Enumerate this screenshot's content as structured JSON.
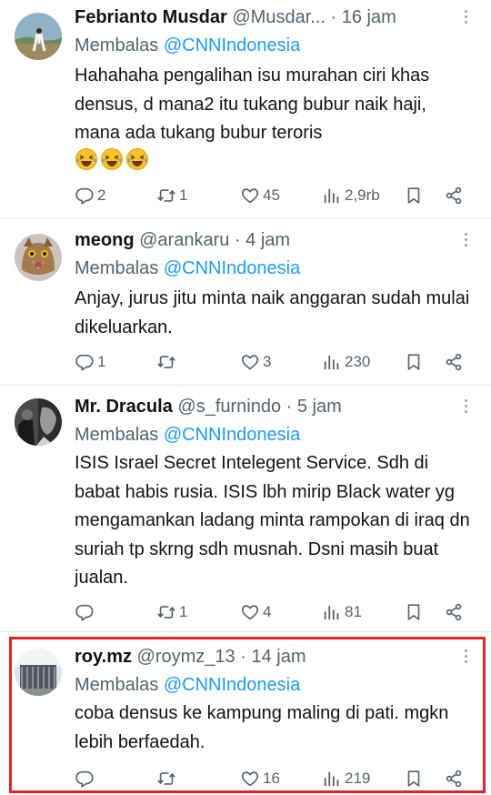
{
  "replies": [
    {
      "name": "Febrianto Musdar",
      "handle": "@Musdar...",
      "separator": "·",
      "time": "16 jam",
      "reply_prefix": "Membalas",
      "reply_to": "@CNNIndonesia",
      "text": "Hahahaha pengalihan isu murahan ciri khas densus, d mana2 itu tukang bubur naik haji, mana ada tukang bubur teroris",
      "emojis": [
        "rolling-on-floor-laughing-emoji",
        "rolling-on-floor-laughing-emoji",
        "rolling-on-floor-laughing-emoji"
      ],
      "stats": {
        "replies": "2",
        "reposts": "1",
        "likes": "45",
        "views": "2,9rb"
      }
    },
    {
      "name": "meong",
      "handle": "@arankaru",
      "separator": "·",
      "time": "4 jam",
      "reply_prefix": "Membalas",
      "reply_to": "@CNNIndonesia",
      "text": "Anjay, jurus jitu minta naik anggaran sudah mulai dikeluarkan.",
      "stats": {
        "replies": "1",
        "reposts": "",
        "likes": "3",
        "views": "230"
      }
    },
    {
      "name": "Mr. Dracula",
      "handle": "@s_furnindo",
      "separator": "·",
      "time": "5 jam",
      "reply_prefix": "Membalas",
      "reply_to": "@CNNIndonesia",
      "text": "ISIS Israel Secret Intelegent Service. Sdh di babat habis rusia. ISIS lbh mirip Black water yg mengamankan ladang minta rampokan di iraq dn suriah tp skrng sdh musnah. Dsni masih buat jualan.",
      "stats": {
        "replies": "",
        "reposts": "1",
        "likes": "4",
        "views": "81"
      }
    },
    {
      "name": "roy.mz",
      "handle": "@roymz_13",
      "separator": "·",
      "time": "14 jam",
      "reply_prefix": "Membalas",
      "reply_to": "@CNNIndonesia",
      "text": "coba densus ke kampung maling di pati. mgkn lebih berfaedah.",
      "stats": {
        "replies": "",
        "reposts": "",
        "likes": "16",
        "views": "219"
      }
    }
  ],
  "icons": {
    "reply": "reply-icon",
    "repost": "repost-icon",
    "like": "heart-icon",
    "views": "views-icon",
    "bookmark": "bookmark-icon",
    "share": "share-icon",
    "more": "more-options-icon"
  },
  "colors": {
    "text": "#0f1419",
    "secondary": "#536471",
    "link": "#1d9bf0",
    "highlight_border": "#e0242c"
  }
}
